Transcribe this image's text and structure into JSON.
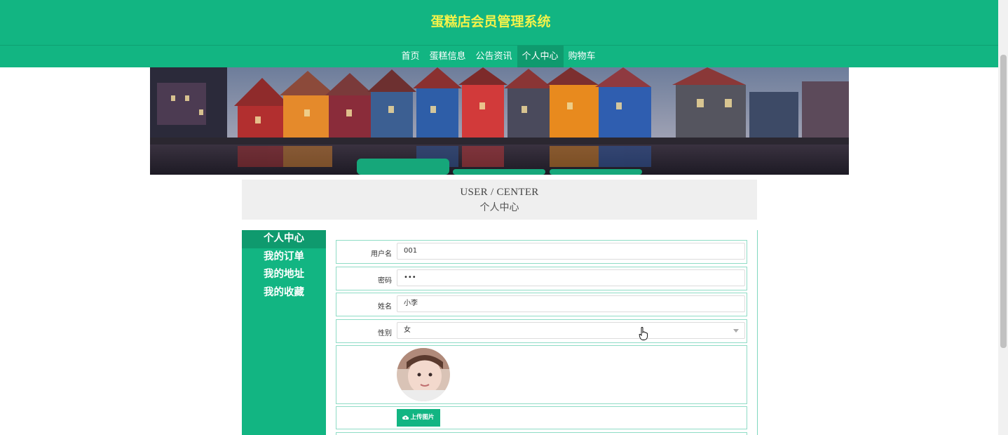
{
  "header": {
    "title": "蛋糕店会员管理系统",
    "nav": [
      "首页",
      "蛋糕信息",
      "公告资讯",
      "个人中心",
      "购物车"
    ],
    "active_nav": "个人中心"
  },
  "section_title": {
    "en": "USER / CENTER",
    "cn": "个人中心"
  },
  "sidebar": {
    "items": [
      "个人中心",
      "我的订单",
      "我的地址",
      "我的收藏"
    ],
    "active": "个人中心"
  },
  "form": {
    "username": {
      "label": "用户名",
      "value": "001"
    },
    "password": {
      "label": "密码",
      "value": "•••"
    },
    "name": {
      "label": "姓名",
      "value": "小李"
    },
    "gender": {
      "label": "性别",
      "value": "女"
    },
    "upload_label": "上传图片"
  },
  "colors": {
    "primary": "#12b582",
    "active": "#0f9a6e",
    "title": "#f4f24a"
  }
}
